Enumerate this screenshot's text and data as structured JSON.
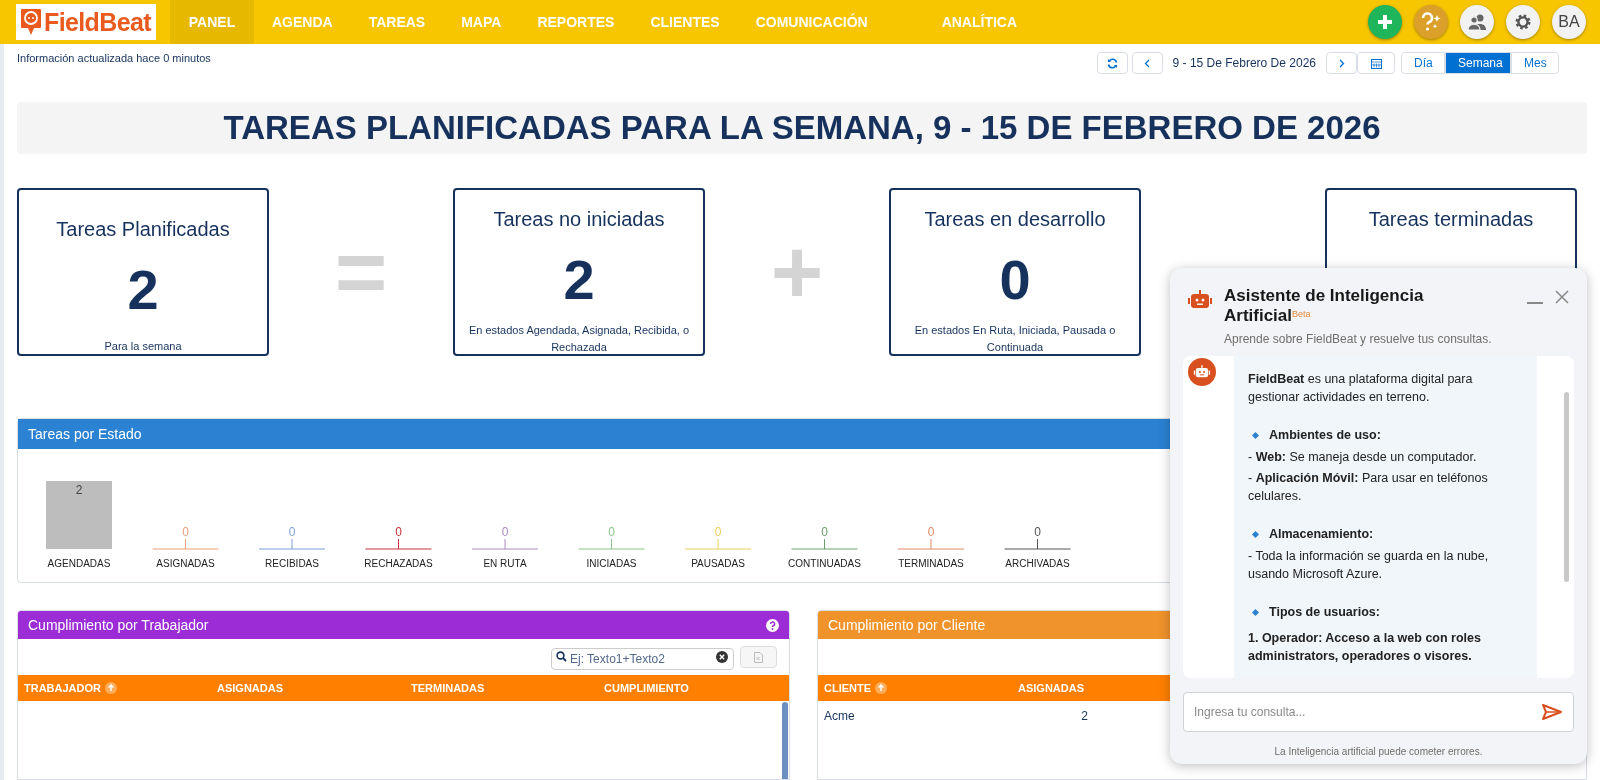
{
  "nav": {
    "logo": "FieldBeat",
    "items": [
      {
        "label": "PANEL",
        "selected": true
      },
      {
        "label": "AGENDA",
        "selected": false
      },
      {
        "label": "TAREAS",
        "selected": false
      },
      {
        "label": "MAPA",
        "selected": false
      },
      {
        "label": "REPORTES",
        "selected": false
      },
      {
        "label": "CLIENTES",
        "selected": false
      },
      {
        "label": "COMUNICACIÓN",
        "selected": false
      },
      {
        "label": "ANALÍTICA",
        "selected": false
      }
    ],
    "avatar": "BA"
  },
  "updated_note": "Información actualizada hace 0 minutos",
  "date_range": "9 - 15 De Febrero De 2026",
  "view_modes": [
    {
      "label": "Día",
      "selected": false
    },
    {
      "label": "Semana",
      "selected": true
    },
    {
      "label": "Mes",
      "selected": false
    }
  ],
  "page_title": "TAREAS PLANIFICADAS PARA LA SEMANA, 9 - 15 DE FEBRERO DE 2026",
  "cards": [
    {
      "title": "Tareas Planificadas",
      "value": "2",
      "note": "Para la semana"
    },
    {
      "title": "Tareas no iniciadas",
      "value": "2",
      "note": "En estados Agendada, Asignada, Recibida, o Rechazada"
    },
    {
      "title": "Tareas en desarrollo",
      "value": "0",
      "note": "En estados En Ruta, Iniciada, Pausada o Continuada"
    },
    {
      "title": "Tareas terminadas"
    }
  ],
  "operators": [
    "=",
    "+"
  ],
  "status_chart": {
    "title": "Tareas por Estado",
    "chart_data": {
      "type": "bar",
      "categories": [
        "AGENDADAS",
        "ASIGNADAS",
        "RECIBIDAS",
        "RECHAZADAS",
        "EN RUTA",
        "INICIADAS",
        "PAUSADAS",
        "CONTINUADAS",
        "TERMINADAS",
        "ARCHIVADAS"
      ],
      "values": [
        2,
        0,
        0,
        0,
        0,
        0,
        0,
        0,
        0,
        0
      ],
      "colors": [
        "#bdbdbd",
        "#e8a07a",
        "#7e9fd6",
        "#c8323c",
        "#a98ac4",
        "#8ac48a",
        "#e8cf5a",
        "#6aa06a",
        "#e0896a",
        "#555555"
      ],
      "data_labels": true
    }
  },
  "worker_table": {
    "title": "Cumplimiento por Trabajador",
    "search_placeholder": "Ej: Texto1+Texto2",
    "columns": [
      "TRABAJADOR",
      "ASIGNADAS",
      "TERMINADAS",
      "CUMPLIMIENTO"
    ]
  },
  "client_table": {
    "title": "Cumplimiento por Cliente",
    "columns": [
      "CLIENTE",
      "ASIGNADAS"
    ],
    "rows": [
      [
        "Acme",
        "2"
      ]
    ]
  },
  "assistant": {
    "title": "Asistente de Inteligencia Artificial$^{Beta}$",
    "subtitle": "Aprende sobre FieldBeat y resuelve tus consultas.",
    "message": [
      {
        "kind": "text",
        "text": "**FieldBeat** es una plataforma digital para gestionar actividades en terreno."
      },
      {
        "kind": "heading",
        "text": "Ambientes de uso:"
      },
      {
        "kind": "text",
        "text": "- **Web:** Se maneja desde un computador."
      },
      {
        "kind": "text",
        "text": "- **Aplicación Móvil:** Para usar en teléfonos celulares."
      },
      {
        "kind": "heading",
        "text": "Almacenamiento:"
      },
      {
        "kind": "text",
        "text": "- Toda la información se guarda en la nube, usando Microsoft Azure."
      },
      {
        "kind": "heading",
        "text": "Tipos de usuarios:"
      },
      {
        "kind": "strong",
        "text": "1. Operador: Acceso a la web con roles administrators, operadores o visores."
      }
    ],
    "input_placeholder": "Ingresa tu consulta...",
    "disclaimer": "La Inteligencia artificial puede cometer errores."
  }
}
